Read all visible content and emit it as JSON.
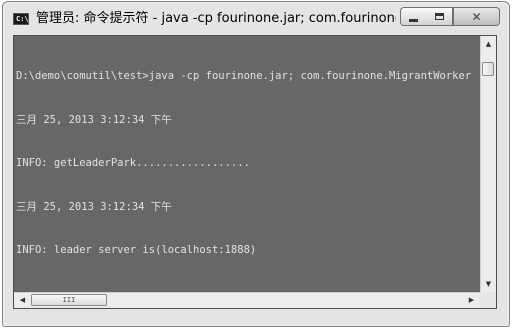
{
  "window": {
    "title": "管理员: 命令提示符 - java  -cp fourinone.jar; com.fourinone.Migrant...",
    "app_icon_text": "C:\\",
    "app_icon_name": "cmd-icon",
    "controls": {
      "minimize_icon": "minimize-icon",
      "maximize_icon": "maximize-icon",
      "close_glyph": "✕"
    }
  },
  "console": {
    "lines": [
      "D:\\demo\\comutil\\test>java -cp fourinone.jar; com.fourinone.MigrantWorker",
      "三月 25, 2013 3:12:34 下午",
      "INFO: getLeaderPark..................",
      "三月 25, 2013 3:12:34 下午",
      "INFO: leader server is(localhost:1888)"
    ],
    "background": "#676767",
    "text_color": "#e2e2e2"
  },
  "scrollbars": {
    "up_arrow": "▲",
    "down_arrow": "▼",
    "left_arrow": "◀",
    "right_arrow": "▶",
    "h_thumb_grip": "III"
  }
}
